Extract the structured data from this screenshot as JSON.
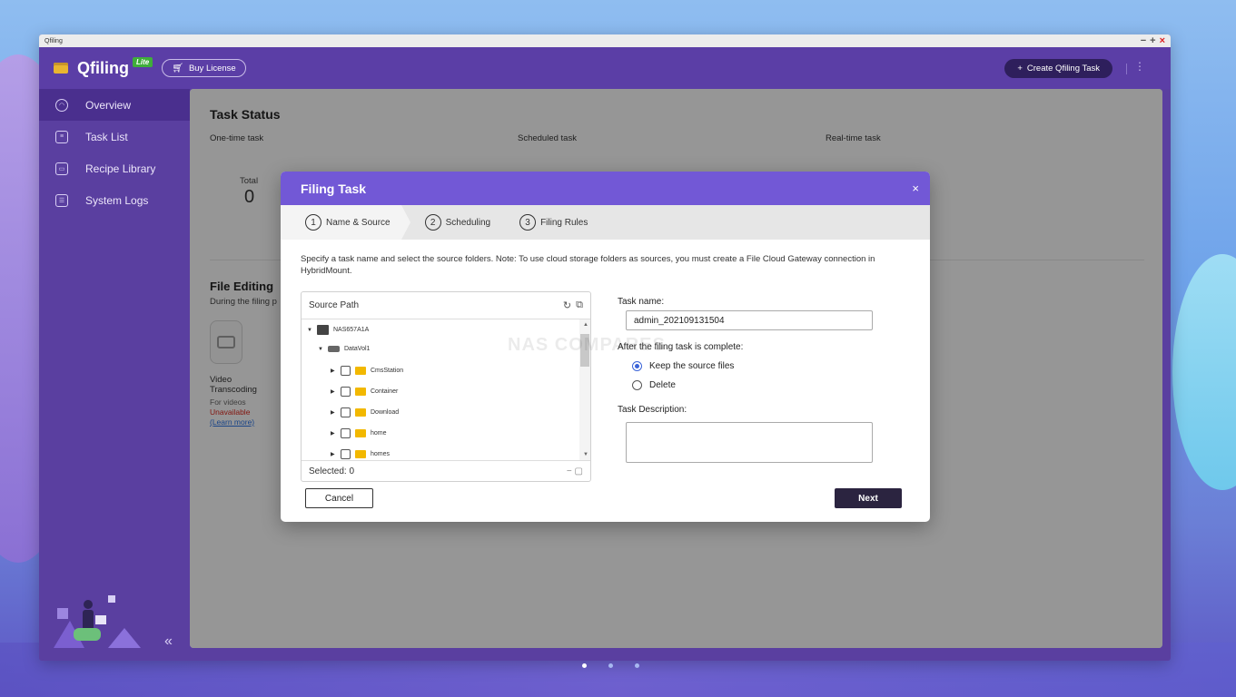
{
  "window": {
    "title": "Qfiling"
  },
  "header": {
    "app_name": "Qfiling",
    "edition_badge": "Lite",
    "buy_license_label": "Buy License",
    "create_task_label": "Create Qfiling Task",
    "more_icon": "kebab-icon"
  },
  "sidebar": {
    "items": [
      {
        "label": "Overview",
        "icon": "overview-icon",
        "active": true
      },
      {
        "label": "Task List",
        "icon": "task-list-icon",
        "active": false
      },
      {
        "label": "Recipe Library",
        "icon": "recipe-library-icon",
        "active": false
      },
      {
        "label": "System Logs",
        "icon": "system-logs-icon",
        "active": false
      }
    ],
    "collapse_glyph": "«"
  },
  "main": {
    "task_status_title": "Task Status",
    "columns": [
      "One-time task",
      "Scheduled task",
      "Real-time task"
    ],
    "total_label": "Total",
    "total_value": "0",
    "file_editing_title": "File Editing",
    "file_editing_sub": "During the filing p",
    "feature": {
      "name": "Video Transcoding",
      "for": "For videos",
      "status": "Unavailable",
      "learn_more": "(Learn more)"
    },
    "watermark": "NAS COMPARES"
  },
  "dialog": {
    "title": "Filing Task",
    "close_glyph": "×",
    "steps": [
      {
        "num": "1",
        "label": "Name & Source"
      },
      {
        "num": "2",
        "label": "Scheduling"
      },
      {
        "num": "3",
        "label": "Filing Rules"
      }
    ],
    "note": "Specify a task name and select the source folders. Note: To use cloud storage folders as sources, you must create a File Cloud Gateway connection in HybridMount.",
    "source": {
      "header": "Source Path",
      "tree": {
        "nas": "NAS657A1A",
        "volume": "DataVol1",
        "folders": [
          "CmsStation",
          "Container",
          "Download",
          "home",
          "homes"
        ]
      },
      "selected_label": "Selected: 0"
    },
    "task_name_label": "Task name:",
    "task_name_value": "admin_202109131504",
    "after_complete_label": "After the filing task is complete:",
    "options": [
      {
        "label": "Keep the source files",
        "selected": true
      },
      {
        "label": "Delete",
        "selected": false
      }
    ],
    "description_label": "Task Description:",
    "description_value": "",
    "cancel_label": "Cancel",
    "next_label": "Next"
  },
  "colors": {
    "brand": "#5b3ea6",
    "dialog_header": "#7258d6",
    "primary_button": "#2b2440",
    "warning": "#d4281e"
  }
}
